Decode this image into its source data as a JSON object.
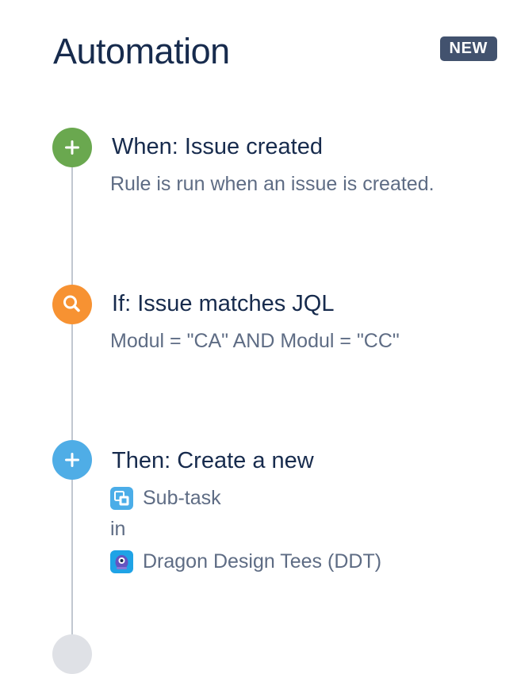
{
  "header": {
    "title": "Automation",
    "badge": "NEW"
  },
  "steps": [
    {
      "title": "When: Issue created",
      "description": "Rule is run when an issue is created.",
      "icon": "plus-icon",
      "color": "#6aa84f"
    },
    {
      "title": "If: Issue matches JQL",
      "description": "Modul = \"CA\" AND Modul = \"CC\"",
      "icon": "search-icon",
      "color": "#f79232"
    },
    {
      "title": "Then: Create a new",
      "issue_type": "Sub-task",
      "connector": "in",
      "project": "Dragon Design Tees (DDT)",
      "icon": "plus-icon",
      "color": "#4fade6"
    }
  ],
  "colors": {
    "text_primary": "#172b4d",
    "text_secondary": "#5e6c84",
    "badge_bg": "#42526e",
    "line": "#c1c7d0"
  }
}
